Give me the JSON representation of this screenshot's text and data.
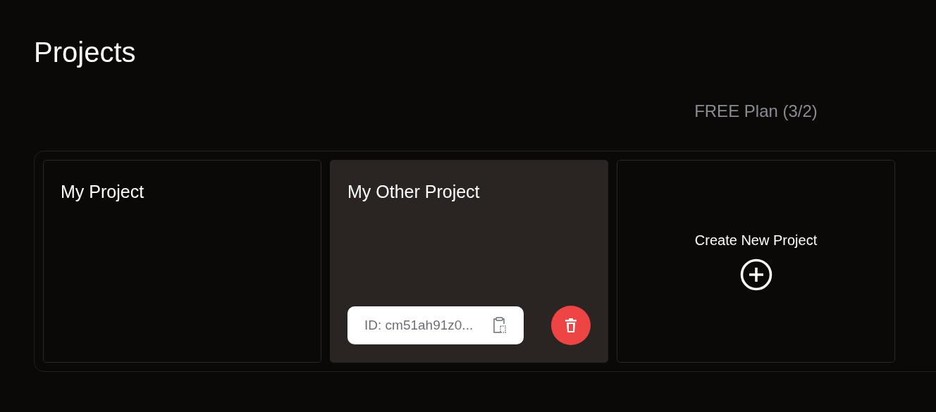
{
  "page_title": "Projects",
  "plan_label": "FREE Plan (3/2)",
  "projects": [
    {
      "name": "My Project",
      "hovered": false
    },
    {
      "name": "My Other Project",
      "hovered": true,
      "id_label": "ID: cm51ah91z0..."
    }
  ],
  "create_label": "Create New Project"
}
